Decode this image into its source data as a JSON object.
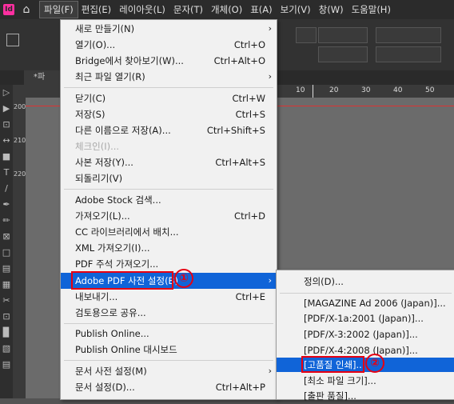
{
  "menubar": {
    "logo": "Id",
    "home_icon": "home-icon",
    "items": [
      "파일(F)",
      "편집(E)",
      "레이아웃(L)",
      "문자(T)",
      "개체(O)",
      "표(A)",
      "보기(V)",
      "창(W)",
      "도움말(H)"
    ]
  },
  "document": {
    "tab_label": "*파"
  },
  "ruler": {
    "h_numbers": [
      "10",
      "20",
      "30",
      "40",
      "50"
    ],
    "v_numbers": [
      "200",
      "210",
      "220"
    ]
  },
  "file_menu": [
    {
      "label": "새로 만들기(N)",
      "shortcut": "",
      "submenu": true
    },
    {
      "label": "열기(O)...",
      "shortcut": "Ctrl+O"
    },
    {
      "label": "Bridge에서 찾아보기(W)...",
      "shortcut": "Ctrl+Alt+O"
    },
    {
      "label": "최근 파일 열기(R)",
      "shortcut": "",
      "submenu": true
    },
    {
      "label": "닫기(C)",
      "shortcut": "Ctrl+W"
    },
    {
      "label": "저장(S)",
      "shortcut": "Ctrl+S"
    },
    {
      "label": "다른 이름으로 저장(A)...",
      "shortcut": "Ctrl+Shift+S"
    },
    {
      "label": "체크인(I)...",
      "shortcut": "",
      "disabled": true
    },
    {
      "label": "사본 저장(Y)...",
      "shortcut": "Ctrl+Alt+S"
    },
    {
      "label": "되돌리기(V)",
      "shortcut": ""
    },
    {
      "label": "Adobe Stock 검색...",
      "shortcut": ""
    },
    {
      "label": "가져오기(L)...",
      "shortcut": "Ctrl+D"
    },
    {
      "label": "CC 라이브러리에서 배치...",
      "shortcut": ""
    },
    {
      "label": "XML 가져오기(I)...",
      "shortcut": ""
    },
    {
      "label": "PDF 주석 가져오기...",
      "shortcut": ""
    },
    {
      "label": "Adobe PDF 사전 설정(B)",
      "shortcut": "",
      "submenu": true,
      "highlighted": true
    },
    {
      "label": "내보내기...",
      "shortcut": "Ctrl+E"
    },
    {
      "label": "검토용으로 공유...",
      "shortcut": ""
    },
    {
      "label": "Publish Online...",
      "shortcut": ""
    },
    {
      "label": "Publish Online 대시보드",
      "shortcut": ""
    },
    {
      "label": "문서 사전 설정(M)",
      "shortcut": "",
      "submenu": true
    },
    {
      "label": "문서 설정(D)...",
      "shortcut": "Ctrl+Alt+P"
    },
    {
      "label": "사용자...",
      "shortcut": ""
    }
  ],
  "pdf_submenu": [
    {
      "label": "정의(D)..."
    },
    {
      "label": "[MAGAZINE Ad 2006 (Japan)]..."
    },
    {
      "label": "[PDF/X-1a:2001 (Japan)]..."
    },
    {
      "label": "[PDF/X-3:2002 (Japan)]..."
    },
    {
      "label": "[PDF/X-4:2008 (Japan)]..."
    },
    {
      "label": "[고품질 인쇄]...",
      "highlighted": true
    },
    {
      "label": "[최소 파일 크기]..."
    },
    {
      "label": "[출판 품질]..."
    }
  ],
  "annotations": {
    "marker1": "①",
    "marker2": "②",
    "marker_color": "#e60012"
  },
  "colors": {
    "highlight": "#1064d8",
    "brand": "#ff2fa0"
  }
}
